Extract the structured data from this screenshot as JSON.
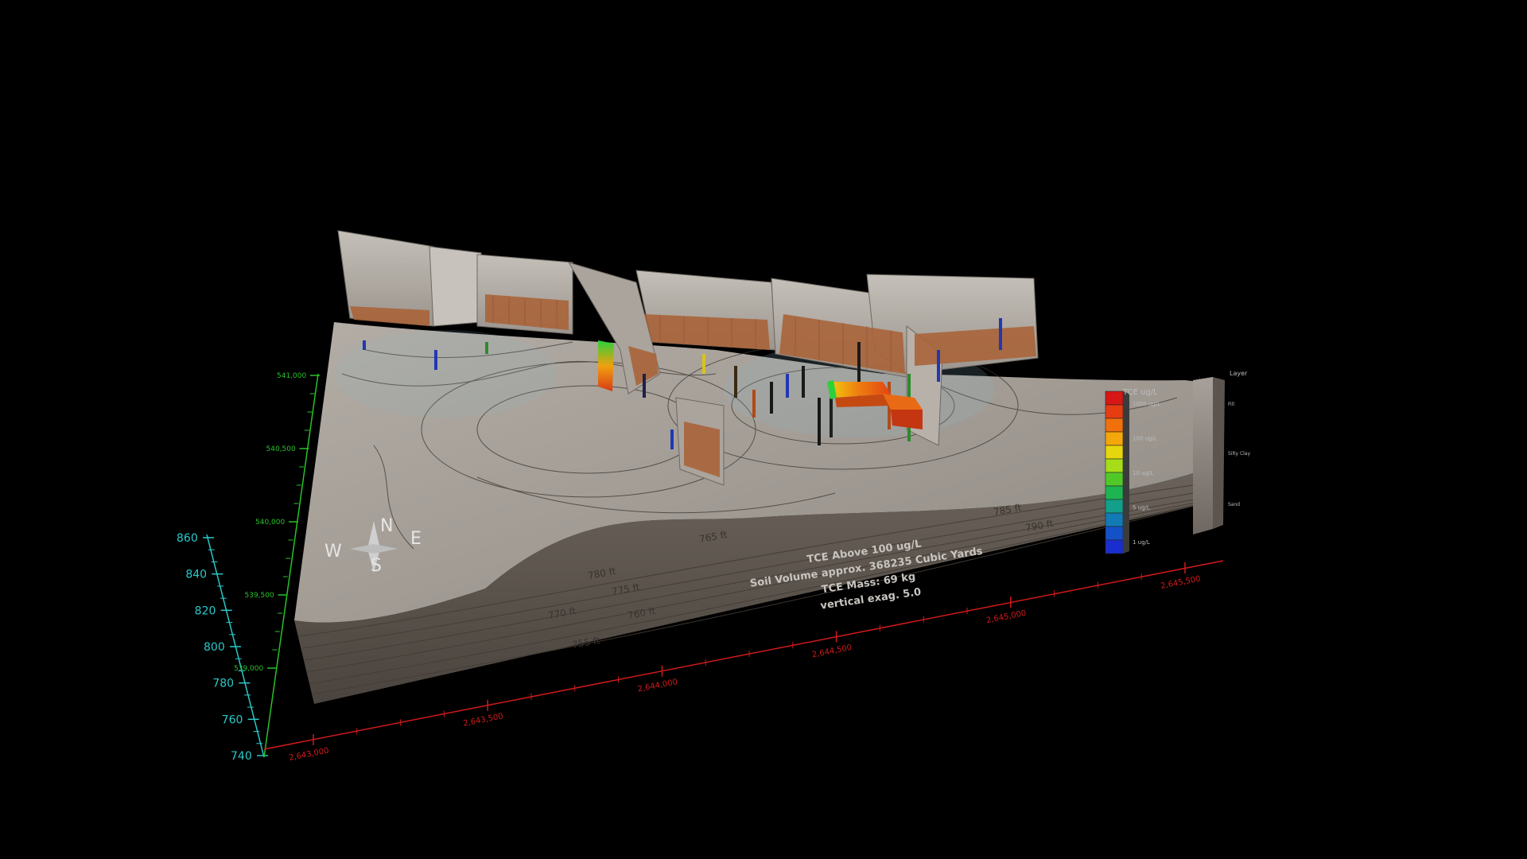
{
  "colors": {
    "background": "#000000",
    "x_axis": "#d01a1a",
    "y_axis": "#27c22a",
    "z_axis": "#29c9c9",
    "terrain_top": "#a9a39d",
    "terrain_side": "#5f5750",
    "section_panel": "#b7b2ab",
    "clay_layer": "#b06a3e"
  },
  "z_axis": {
    "ticks": [
      "860",
      "840",
      "820",
      "800",
      "780",
      "760",
      "740"
    ]
  },
  "y_axis": {
    "ticks": [
      "541,000",
      "540,500",
      "540,000",
      "539,500",
      "539,000"
    ]
  },
  "x_axis": {
    "ticks": [
      "2,643,000",
      "2,643,500",
      "2,644,000",
      "2,644,500",
      "2,645,000",
      "2,645,500"
    ]
  },
  "compass": {
    "north": "N",
    "south": "S",
    "east": "E",
    "west": "W"
  },
  "annotation": {
    "line1": "TCE Above 100 ug/L",
    "line2": "Soil Volume approx. 368235 Cubic Yards",
    "line3": "TCE Mass: 69 kg",
    "line4": "vertical exag. 5.0"
  },
  "contour_labels": [
    "765 ft",
    "780 ft",
    "775 ft",
    "770 ft",
    "760 ft",
    "755 ft",
    "785 ft",
    "790 ft"
  ],
  "color_scale": {
    "title": "TCE ug/L",
    "stops": [
      "#d81616",
      "#e63c12",
      "#f0700c",
      "#f4a60a",
      "#e6d60e",
      "#a6dc18",
      "#52c828",
      "#1eb450",
      "#12a08a",
      "#127ab4",
      "#1450c8",
      "#1a2ed0"
    ],
    "labels": [
      "1000 ug/L",
      "100 ug/L",
      "10 ug/L",
      "5 ug/L",
      "1 ug/L"
    ]
  },
  "layer_legend": {
    "title": "Layer",
    "labels": [
      "Fill",
      "Silty Clay",
      "Sand"
    ]
  }
}
